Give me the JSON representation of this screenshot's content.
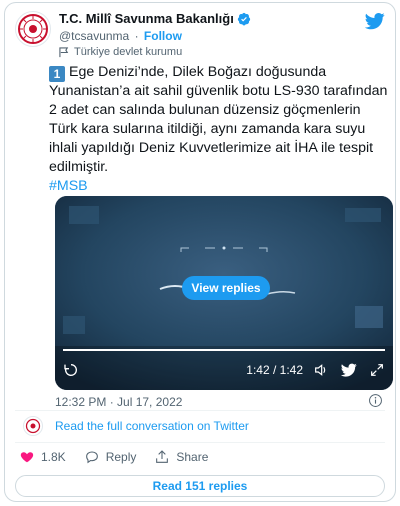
{
  "account": {
    "name": "T.C. Millî Savunma Bakanlığı",
    "handle": "@tcsavunma",
    "separator": "·",
    "follow_label": "Follow",
    "label": "Türkiye devlet kurumu"
  },
  "tweet": {
    "number_badge": "1",
    "text": "Ege Denizi’nde, Dilek Boğazı doğusunda Yunanistan’a ait sahil güvenlik botu LS-930 tarafından 2 adet can salında bulunan düzensiz göçmenlerin Türk kara sularına itildiği, aynı zamanda kara suyu ihlali yapıldığı Deniz Kuvvetlerimize ait İHA ile tespit edilmiştir.",
    "hashtag": "#MSB"
  },
  "video": {
    "view_replies_label": "View replies",
    "time": "1:42 / 1:42",
    "progress": 1.0
  },
  "meta": {
    "timestamp": "12:32 PM · Jul 17, 2022"
  },
  "conversation": {
    "link_label": "Read the full conversation on Twitter"
  },
  "actions": {
    "likes": "1.8K",
    "reply_label": "Reply",
    "share_label": "Share"
  },
  "replies_button": {
    "label": "Read 151 replies"
  },
  "colors": {
    "accent": "#1d9bf0",
    "text": "#0f1419",
    "muted": "#536471",
    "like": "#f91880"
  },
  "icons": [
    "verified-badge-icon",
    "twitter-bird-icon",
    "government-label-icon",
    "replay-icon",
    "volume-icon",
    "twitter-icon",
    "fullscreen-icon",
    "info-icon",
    "heart-icon",
    "reply-icon",
    "share-icon"
  ]
}
